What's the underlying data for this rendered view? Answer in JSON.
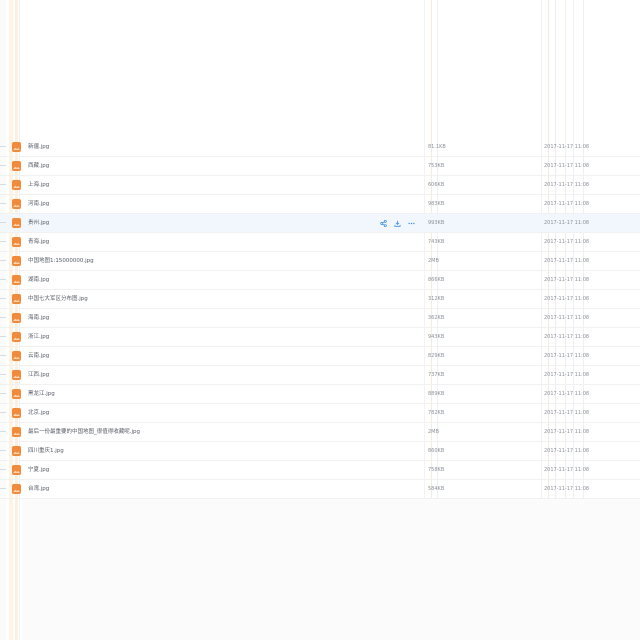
{
  "file_list": {
    "rows": [
      {
        "name": "新疆.jpg",
        "size": "81.1KB",
        "date": "2017-11-17 11:08"
      },
      {
        "name": "西藏.jpg",
        "size": "753KB",
        "date": "2017-11-17 11:08"
      },
      {
        "name": "上海.jpg",
        "size": "606KB",
        "date": "2017-11-17 11:08"
      },
      {
        "name": "河南.jpg",
        "size": "983KB",
        "date": "2017-11-17 11:08"
      },
      {
        "name": "贵州.jpg",
        "size": "993KB",
        "date": "2017-11-17 11:08"
      },
      {
        "name": "青海.jpg",
        "size": "743KB",
        "date": "2017-11-17 11:08"
      },
      {
        "name": "中国地图1:15000000.jpg",
        "size": "2MB",
        "date": "2017-11-17 11:08"
      },
      {
        "name": "湖南.jpg",
        "size": "866KB",
        "date": "2017-11-17 11:08"
      },
      {
        "name": "中国七大军区分布图.jpg",
        "size": "312KB",
        "date": "2017-11-17 11:08"
      },
      {
        "name": "海南.jpg",
        "size": "362KB",
        "date": "2017-11-17 11:08"
      },
      {
        "name": "浙江.jpg",
        "size": "943KB",
        "date": "2017-11-17 11:08"
      },
      {
        "name": "云南.jpg",
        "size": "829KB",
        "date": "2017-11-17 11:08"
      },
      {
        "name": "江西.jpg",
        "size": "737KB",
        "date": "2017-11-17 11:08"
      },
      {
        "name": "黑龙江.jpg",
        "size": "889KB",
        "date": "2017-11-17 11:08"
      },
      {
        "name": "北京.jpg",
        "size": "782KB",
        "date": "2017-11-17 11:08"
      },
      {
        "name": "最后一份最重要的中国地图_很值得收藏呢.jpg",
        "size": "2MB",
        "date": "2017-11-17 11:08"
      },
      {
        "name": "四川重庆1.jpg",
        "size": "860KB",
        "date": "2017-11-17 11:08"
      },
      {
        "name": "宁夏.jpg",
        "size": "758KB",
        "date": "2017-11-17 11:08"
      },
      {
        "name": "台湾.jpg",
        "size": "584KB",
        "date": "2017-11-17 11:08"
      }
    ],
    "hovered_row_index": 4,
    "row_actions": {
      "icons": [
        "share-icon",
        "download-icon",
        "more-icon"
      ]
    }
  },
  "colors": {
    "file_icon": "#f28a3c",
    "action_icon": "#3b8fe0",
    "hover_row": "#f2f7fd"
  }
}
